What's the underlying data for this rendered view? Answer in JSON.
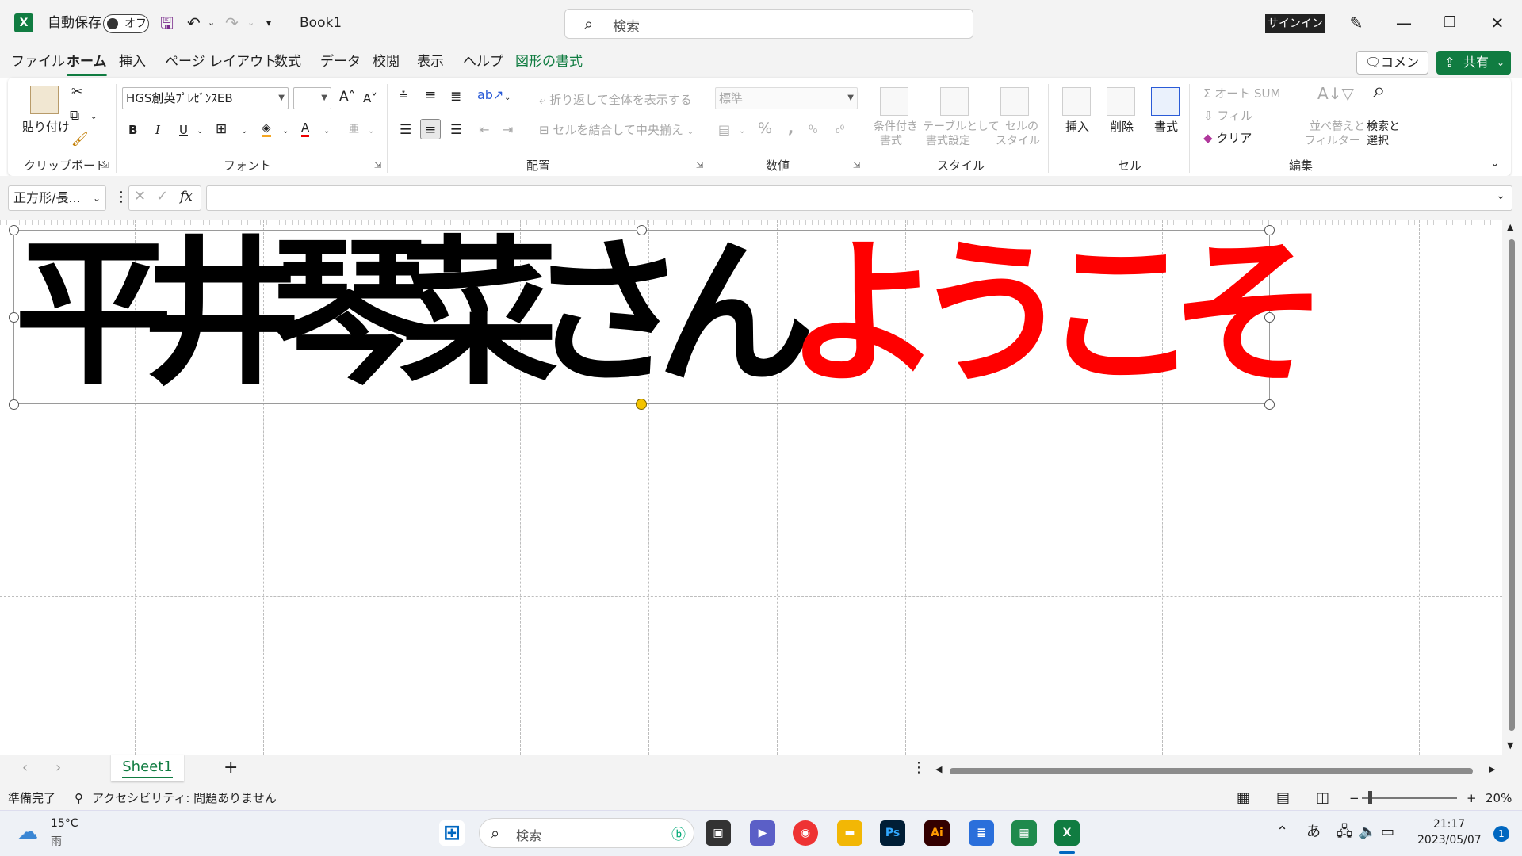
{
  "titlebar": {
    "autosave_label": "自動保存",
    "autosave_state": "オフ",
    "doc_title": "Book1",
    "search_placeholder": "検索",
    "signin": "サインイン"
  },
  "menu": {
    "tabs": [
      "ファイル",
      "ホーム",
      "挿入",
      "ページ レイアウト",
      "数式",
      "データ",
      "校閲",
      "表示",
      "ヘルプ",
      "図形の書式"
    ],
    "active": "ホーム",
    "comment": "コメント",
    "share": "共有"
  },
  "ribbon": {
    "clipboard": {
      "label": "クリップボード",
      "paste": "貼り付け"
    },
    "font": {
      "label": "フォント",
      "font_name": "HGS創英ﾌﾟﾚｾﾞﾝｽEB",
      "font_size": "",
      "bold": "B",
      "italic": "I",
      "underline": "U"
    },
    "alignment": {
      "label": "配置",
      "wrap_text": "折り返して全体を表示する",
      "merge_center": "セルを結合して中央揃え"
    },
    "number": {
      "label": "数値",
      "format": "標準",
      "percent": "%"
    },
    "styles": {
      "label": "スタイル",
      "conditional_1": "条件付き",
      "conditional_2": "書式",
      "table_1": "テーブルとして",
      "table_2": "書式設定",
      "cell_1": "セルの",
      "cell_2": "スタイル"
    },
    "cells": {
      "label": "セル",
      "insert": "挿入",
      "delete": "削除",
      "format": "書式"
    },
    "editing": {
      "label": "編集",
      "autosum": "オート SUM",
      "fill": "フィル",
      "clear": "クリア",
      "sort_1": "並べ替えと",
      "sort_2": "フィルター",
      "find_1": "検索と",
      "find_2": "選択"
    }
  },
  "formula_bar": {
    "name_box": "正方形/長...",
    "fx": "fx",
    "formula": ""
  },
  "shape": {
    "text_name": "平井琴菜さん",
    "text_welcome": "ようこそ",
    "name_color": "#000000",
    "welcome_color": "#ff0000"
  },
  "sheet_tabs": {
    "active": "Sheet1",
    "add": "+"
  },
  "status": {
    "ready": "準備完了",
    "accessibility": "アクセシビリティ: 問題ありません",
    "zoom": "20%"
  },
  "taskbar": {
    "weather_temp": "15°C",
    "weather_desc": "雨",
    "search_placeholder": "検索",
    "ime": "あ",
    "time": "21:17",
    "date": "2023/05/07",
    "notifications": "1"
  },
  "colors": {
    "excel_green": "#107c41",
    "selection_handle": "#f3c300"
  }
}
